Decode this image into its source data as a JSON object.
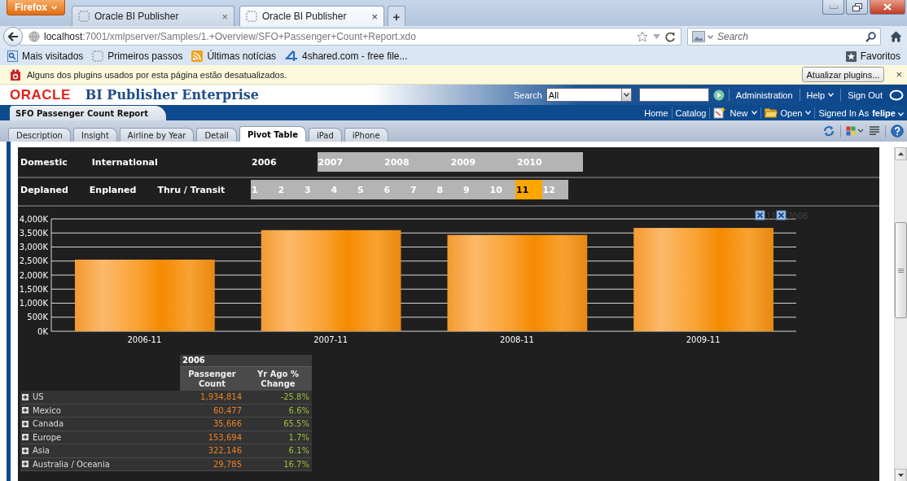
{
  "browser": {
    "menu_button": "Firefox",
    "tabs": [
      {
        "title": "Oracle BI Publisher",
        "selected": false,
        "close": "×"
      },
      {
        "title": "Oracle BI Publisher",
        "selected": true,
        "close": "×"
      }
    ],
    "new_tab": "+",
    "url_host": "localhost",
    "url_path": ":7001/xmlpserver/Samples/1.+Overview/SFO+Passenger+Count+Report.xdo",
    "search_placeholder": "Search",
    "bookmarks": [
      {
        "label": "Mais visitados",
        "kind": "most-visited"
      },
      {
        "label": "Primeiros passos",
        "kind": "page"
      },
      {
        "label": "Últimas notícias",
        "kind": "feed"
      },
      {
        "label": "4shared.com - free file...",
        "kind": "site"
      }
    ],
    "favorites": "Favoritos"
  },
  "notification": {
    "message": "Alguns dos plugins usados por esta página estão desatualizados.",
    "button": "Atualizar plugins...",
    "close": "×"
  },
  "app_header": {
    "logo": "ORACLE",
    "product": "BI Publisher Enterprise",
    "search_label": "Search",
    "search_scope": "All",
    "links": [
      {
        "label": "Administration",
        "dropdown": false
      },
      {
        "label": "Help",
        "dropdown": true
      },
      {
        "label": "Sign Out",
        "dropdown": false
      }
    ]
  },
  "report_bar": {
    "title": "SFO Passenger Count Report",
    "links": [
      {
        "label": "Home",
        "kind": "plain",
        "dropdown": false
      },
      {
        "label": "Catalog",
        "kind": "plain",
        "dropdown": false
      },
      {
        "label": "New",
        "kind": "new",
        "dropdown": true
      },
      {
        "label": "Open",
        "kind": "open",
        "dropdown": true
      }
    ],
    "signed_in_label": "Signed In As",
    "user": "felipe",
    "user_dropdown": true
  },
  "report_tabs": [
    {
      "label": "Description",
      "selected": false
    },
    {
      "label": "Insight",
      "selected": false
    },
    {
      "label": "Airline by Year",
      "selected": false
    },
    {
      "label": "Detail",
      "selected": false
    },
    {
      "label": "Pivot Table",
      "selected": true
    },
    {
      "label": "iPad",
      "selected": false
    },
    {
      "label": "iPhone",
      "selected": false
    }
  ],
  "filters": {
    "flight_types": [
      {
        "label": "Domestic"
      },
      {
        "label": "International"
      }
    ],
    "years": [
      {
        "label": "2006",
        "selected": true
      },
      {
        "label": "2007",
        "selected": false
      },
      {
        "label": "2008",
        "selected": false
      },
      {
        "label": "2009",
        "selected": false
      },
      {
        "label": "2010",
        "selected": false
      }
    ],
    "movements": [
      {
        "label": "Deplaned"
      },
      {
        "label": "Enplaned"
      },
      {
        "label": "Thru / Transit"
      }
    ],
    "months": [
      {
        "label": "1",
        "selected": false
      },
      {
        "label": "2",
        "selected": false
      },
      {
        "label": "3",
        "selected": false
      },
      {
        "label": "4",
        "selected": false
      },
      {
        "label": "5",
        "selected": false
      },
      {
        "label": "6",
        "selected": false
      },
      {
        "label": "7",
        "selected": false
      },
      {
        "label": "8",
        "selected": false
      },
      {
        "label": "9",
        "selected": false
      },
      {
        "label": "10",
        "selected": false
      },
      {
        "label": "11",
        "selected": true
      },
      {
        "label": "12",
        "selected": false
      }
    ]
  },
  "chart": {
    "legend": [
      {
        "label": "11"
      },
      {
        "label": "2006"
      }
    ],
    "chart_data": {
      "type": "bar",
      "categories": [
        "2006-11",
        "2007-11",
        "2008-11",
        "2009-11"
      ],
      "values": [
        2550,
        3600,
        3430,
        3680
      ],
      "ylim": [
        0,
        4000
      ],
      "grid": true,
      "yticks": [
        {
          "value": 0,
          "label": "0K"
        },
        {
          "value": 500,
          "label": "500K"
        },
        {
          "value": 1000,
          "label": "1,000K"
        },
        {
          "value": 1500,
          "label": "1,500K"
        },
        {
          "value": 2000,
          "label": "2,000K"
        },
        {
          "value": 2500,
          "label": "2,500K"
        },
        {
          "value": 3000,
          "label": "3,000K"
        },
        {
          "value": 3500,
          "label": "3,500K"
        },
        {
          "value": 4000,
          "label": "4,000K"
        }
      ]
    }
  },
  "pivot": {
    "year": "2006",
    "columns": [
      "Passenger Count",
      "Yr Ago % Change"
    ],
    "rows": [
      {
        "label": "US",
        "count": "1,934,814",
        "change": "-25.8%"
      },
      {
        "label": "Mexico",
        "count": "60,477",
        "change": "6.6%"
      },
      {
        "label": "Canada",
        "count": "35,666",
        "change": "65.5%"
      },
      {
        "label": "Europe",
        "count": "153,694",
        "change": "1.7%"
      },
      {
        "label": "Asia",
        "count": "322,146",
        "change": "6.1%"
      },
      {
        "label": "Australia / Oceania",
        "count": "29,785",
        "change": "16.7%"
      }
    ]
  }
}
